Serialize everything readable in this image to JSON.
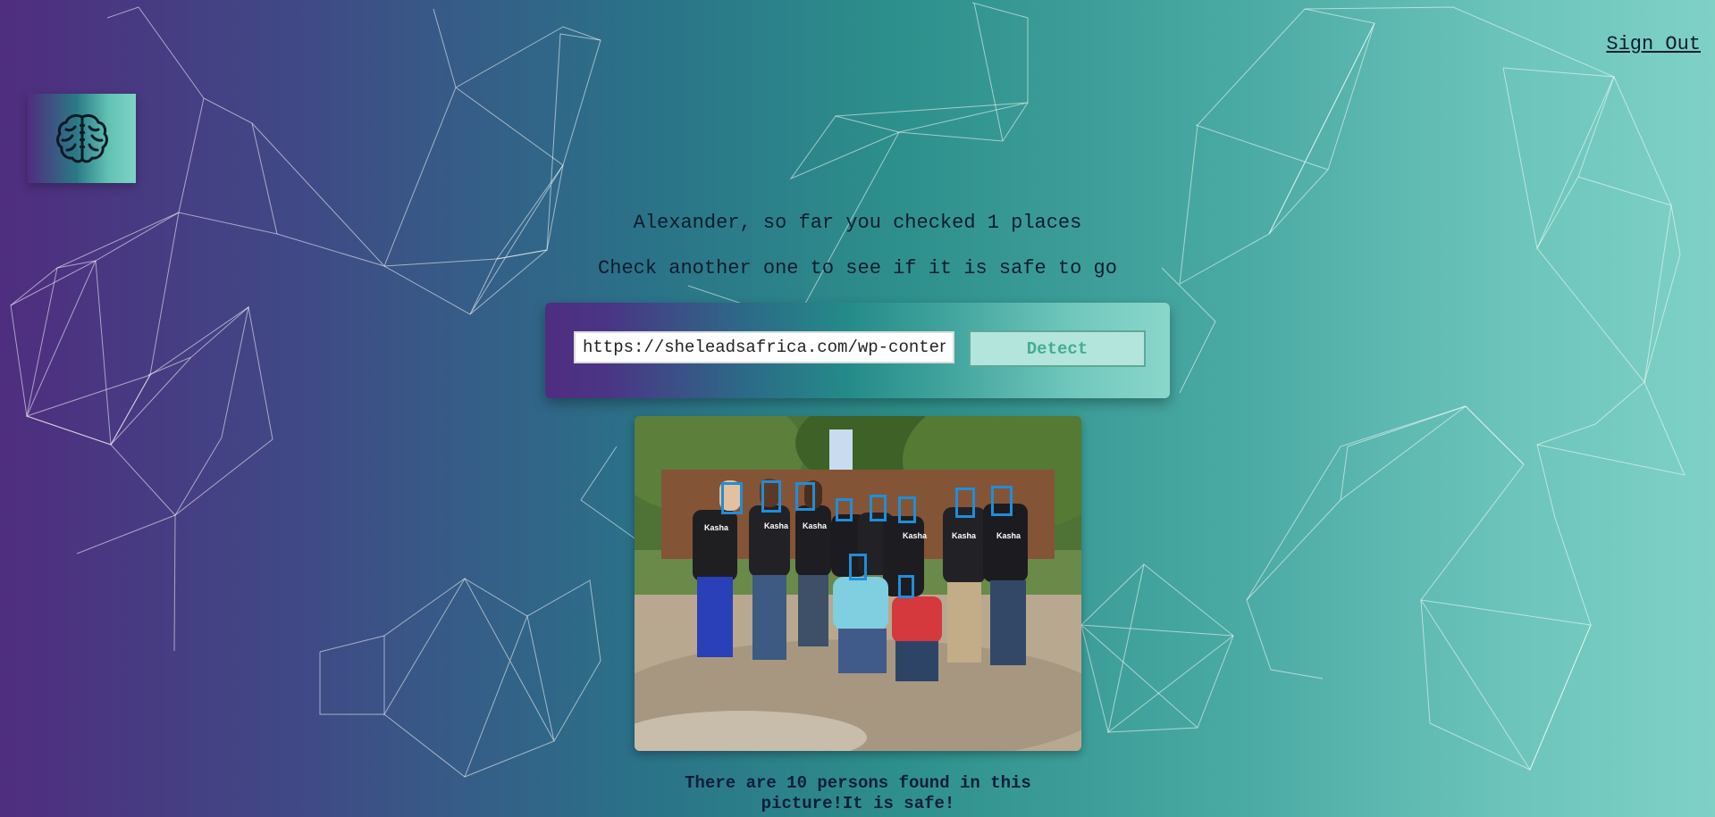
{
  "header": {
    "signout_label": "Sign Out",
    "logo_icon": "brain-icon"
  },
  "main": {
    "greeting": "Alexander, so far you checked 1 places",
    "instruction": "Check another one to see if it is safe to go",
    "url_input_value": "https://sheleadsafrica.com/wp-content/uploads/",
    "detect_label": "Detect",
    "result_text": "There are 10 persons found in this picture!It is safe!"
  },
  "colors": {
    "gradient_start": "#4f2d7f",
    "gradient_end": "#7fd1c6",
    "face_box": "#1f8ed8",
    "detect_text": "#43ad93"
  }
}
